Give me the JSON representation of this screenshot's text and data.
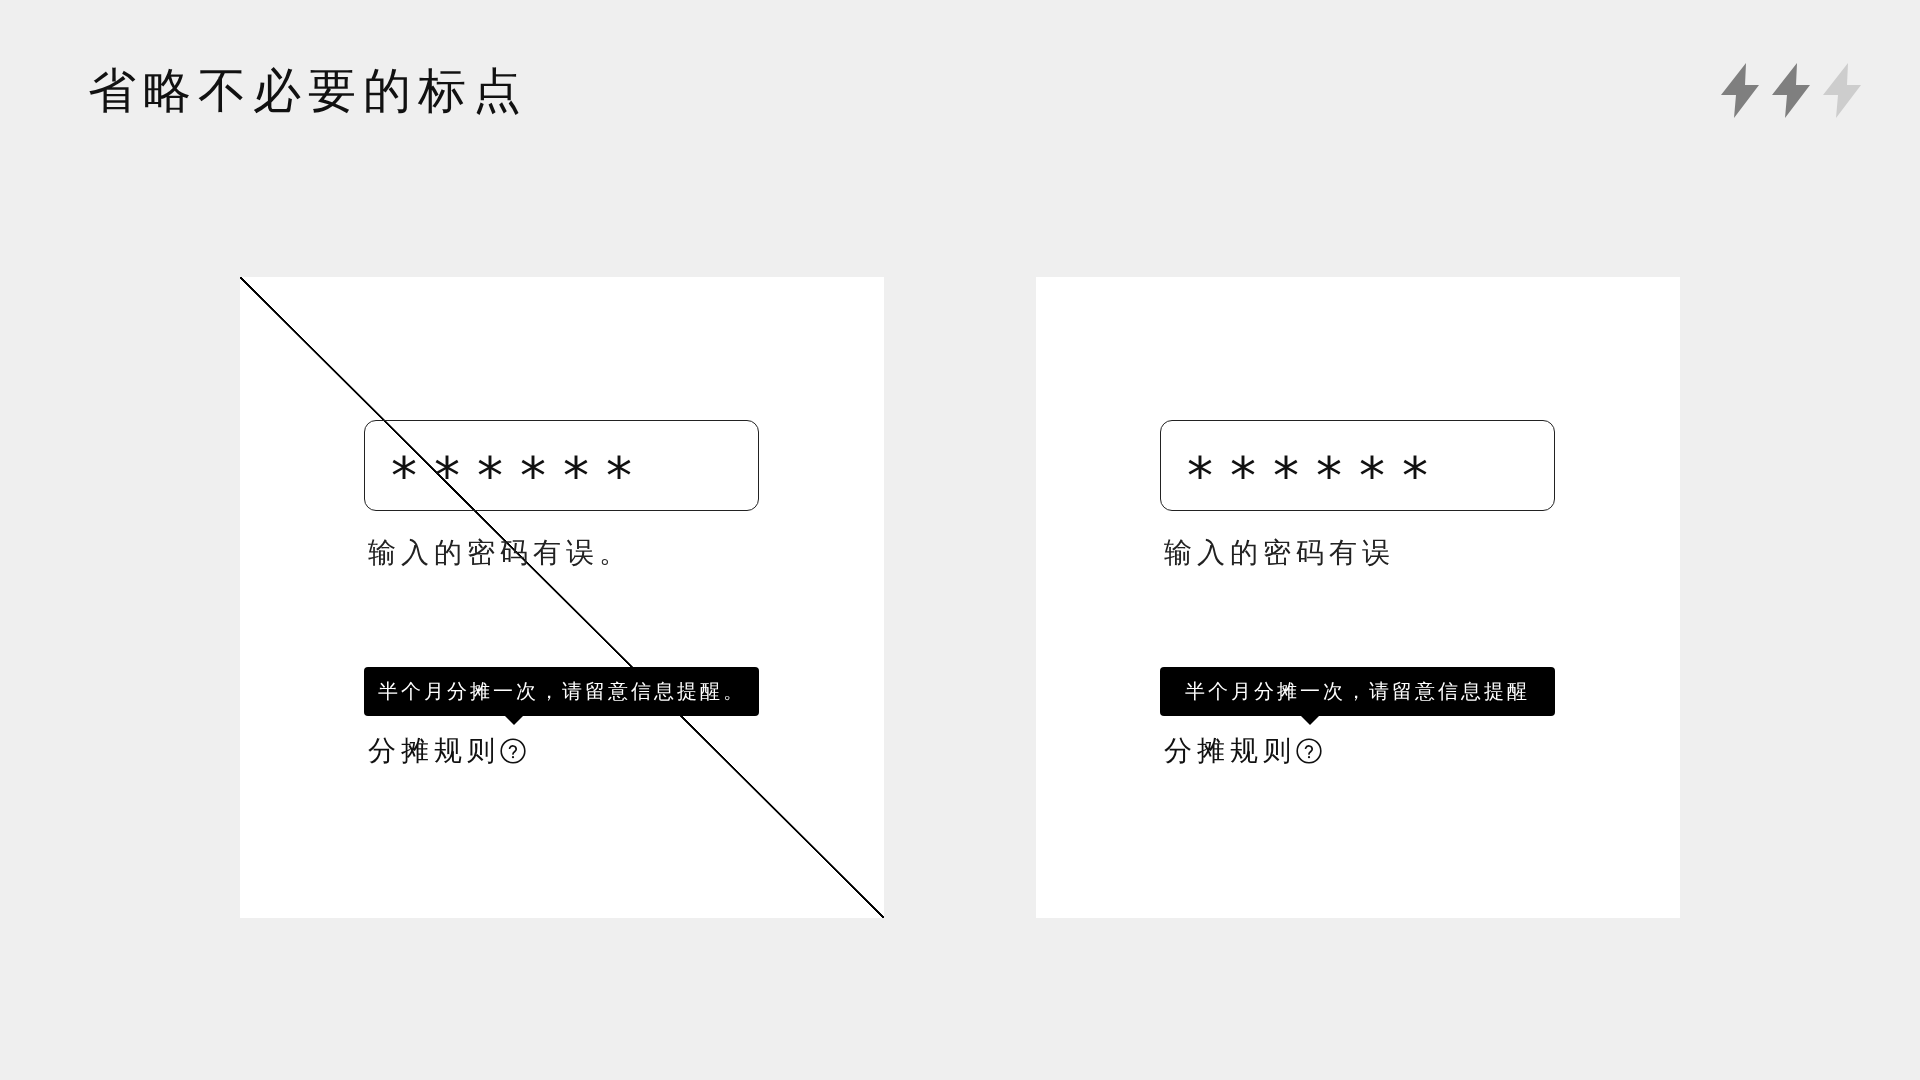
{
  "title": "省略不必要的标点",
  "bolt_indicator": [
    {
      "on": true
    },
    {
      "on": true
    },
    {
      "on": false
    }
  ],
  "examples": [
    {
      "crossed_out": true,
      "password_field": {
        "value": "******"
      },
      "error": "输入的密码有误。",
      "tooltip": "半个月分摊一次，请留意信息提醒。",
      "help_label": "分摊规则"
    },
    {
      "crossed_out": false,
      "password_field": {
        "value": "******"
      },
      "error": "输入的密码有误",
      "tooltip": "半个月分摊一次，请留意信息提醒",
      "help_label": "分摊规则"
    }
  ]
}
